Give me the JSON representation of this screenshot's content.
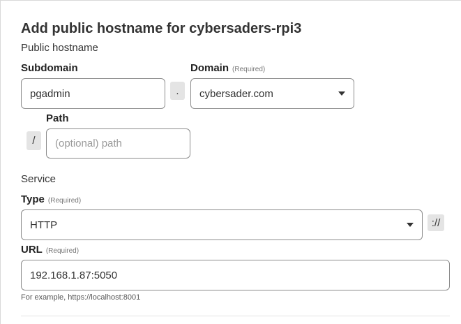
{
  "title": "Add public hostname for cybersaders-rpi3",
  "public_hostname": {
    "section_label": "Public hostname",
    "subdomain": {
      "label": "Subdomain",
      "value": "pgadmin"
    },
    "dot_separator": ".",
    "domain": {
      "label": "Domain",
      "required": "(Required)",
      "value": "cybersader.com"
    },
    "slash_separator": "/",
    "path": {
      "label": "Path",
      "placeholder": "(optional) path"
    }
  },
  "service": {
    "section_label": "Service",
    "type": {
      "label": "Type",
      "required": "(Required)",
      "value": "HTTP"
    },
    "scheme_separator": "://",
    "url": {
      "label": "URL",
      "required": "(Required)",
      "value": "192.168.1.87:5050",
      "hint": "For example, https://localhost:8001"
    }
  }
}
